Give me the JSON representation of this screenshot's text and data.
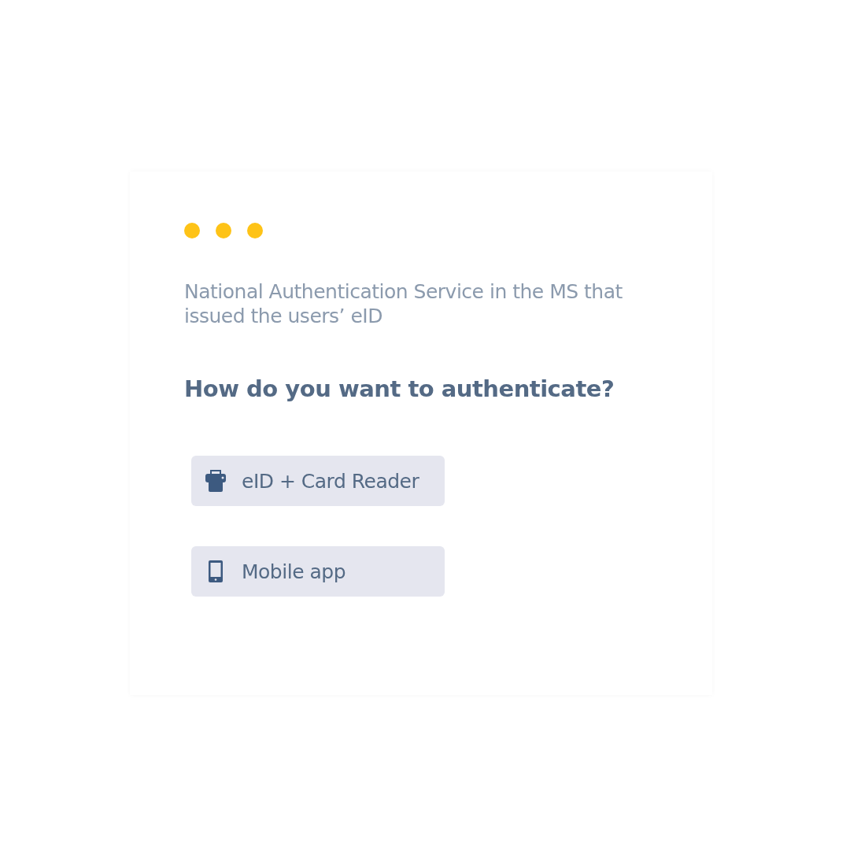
{
  "service_name": "National Authentication Service in the MS that issued the users’ eID",
  "question": "How do you want to authenticate?",
  "options": [
    {
      "kind": "card-reader",
      "label": "eID + Card Reader"
    },
    {
      "kind": "mobile",
      "label": "Mobile app"
    }
  ]
}
